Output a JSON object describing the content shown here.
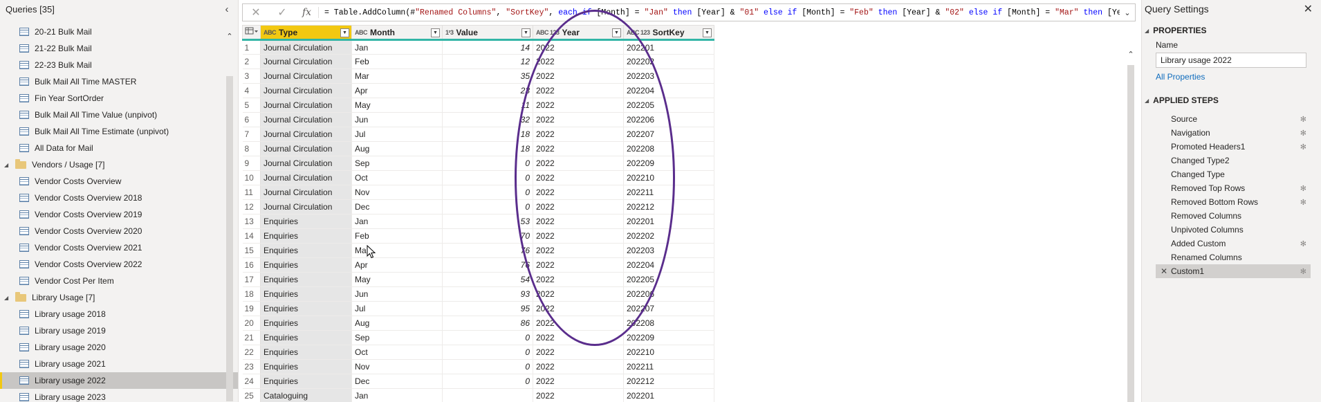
{
  "queries_pane": {
    "title": "Queries [35]",
    "collapse_icon": "chevron-left-icon",
    "items": [
      {
        "kind": "query",
        "label": "20-21 Bulk Mail"
      },
      {
        "kind": "query",
        "label": "21-22 Bulk Mail"
      },
      {
        "kind": "query",
        "label": "22-23 Bulk Mail"
      },
      {
        "kind": "query",
        "label": "Bulk Mail All Time MASTER"
      },
      {
        "kind": "query",
        "label": "Fin Year SortOrder"
      },
      {
        "kind": "query",
        "label": "Bulk Mail All Time Value (unpivot)"
      },
      {
        "kind": "query",
        "label": "Bulk Mail All Time Estimate (unpivot)"
      },
      {
        "kind": "query",
        "label": "All Data for Mail"
      },
      {
        "kind": "folder",
        "label": "Vendors / Usage [7]"
      },
      {
        "kind": "query",
        "label": "Vendor Costs Overview"
      },
      {
        "kind": "query",
        "label": "Vendor Costs Overview 2018"
      },
      {
        "kind": "query",
        "label": "Vendor Costs Overview 2019"
      },
      {
        "kind": "query",
        "label": "Vendor Costs Overview 2020"
      },
      {
        "kind": "query",
        "label": "Vendor Costs Overview 2021"
      },
      {
        "kind": "query",
        "label": "Vendor Costs Overview 2022"
      },
      {
        "kind": "query",
        "label": "Vendor Cost Per Item"
      },
      {
        "kind": "folder",
        "label": "Library Usage [7]"
      },
      {
        "kind": "query",
        "label": "Library usage 2018"
      },
      {
        "kind": "query",
        "label": "Library usage 2019"
      },
      {
        "kind": "query",
        "label": "Library usage 2020"
      },
      {
        "kind": "query",
        "label": "Library usage 2021"
      },
      {
        "kind": "query",
        "label": "Library usage 2022",
        "selected": true
      },
      {
        "kind": "query",
        "label": "Library usage 2023"
      }
    ]
  },
  "formula_bar": {
    "cancel_icon": "✕",
    "commit_icon": "✓",
    "fx_label": "fx",
    "parts": [
      {
        "t": "plain",
        "v": "= Table.AddColumn(#"
      },
      {
        "t": "str",
        "v": "\"Renamed Columns\""
      },
      {
        "t": "plain",
        "v": ", "
      },
      {
        "t": "str",
        "v": "\"SortKey\""
      },
      {
        "t": "plain",
        "v": ", "
      },
      {
        "t": "kw",
        "v": "each if "
      },
      {
        "t": "plain",
        "v": "[Month] = "
      },
      {
        "t": "str",
        "v": "\"Jan\""
      },
      {
        "t": "kw",
        "v": " then "
      },
      {
        "t": "plain",
        "v": "[Year] & "
      },
      {
        "t": "str",
        "v": "\"01\""
      },
      {
        "t": "kw",
        "v": " else if "
      },
      {
        "t": "plain",
        "v": "[Month] = "
      },
      {
        "t": "str",
        "v": "\"Feb\""
      },
      {
        "t": "kw",
        "v": " then "
      },
      {
        "t": "plain",
        "v": "[Year] & "
      },
      {
        "t": "str",
        "v": "\"02\""
      },
      {
        "t": "kw",
        "v": " else if "
      },
      {
        "t": "plain",
        "v": "[Month] = "
      },
      {
        "t": "str",
        "v": "\"Mar\""
      },
      {
        "t": "kw",
        "v": " then "
      },
      {
        "t": "plain",
        "v": "[Year] &"
      }
    ],
    "expand_icon": "chevron-down-icon"
  },
  "grid": {
    "columns": [
      {
        "name": "Type",
        "type_icon": "ABC",
        "highlight": true
      },
      {
        "name": "Month",
        "type_icon": "ABC"
      },
      {
        "name": "Value",
        "type_icon": "1²3"
      },
      {
        "name": "Year",
        "type_icon": "ABC 123"
      },
      {
        "name": "SortKey",
        "type_icon": "ABC 123"
      }
    ],
    "rows": [
      [
        "Journal Circulation",
        "Jan",
        "14",
        "2022",
        "202201"
      ],
      [
        "Journal Circulation",
        "Feb",
        "12",
        "2022",
        "202202"
      ],
      [
        "Journal Circulation",
        "Mar",
        "35",
        "2022",
        "202203"
      ],
      [
        "Journal Circulation",
        "Apr",
        "23",
        "2022",
        "202204"
      ],
      [
        "Journal Circulation",
        "May",
        "11",
        "2022",
        "202205"
      ],
      [
        "Journal Circulation",
        "Jun",
        "32",
        "2022",
        "202206"
      ],
      [
        "Journal Circulation",
        "Jul",
        "18",
        "2022",
        "202207"
      ],
      [
        "Journal Circulation",
        "Aug",
        "18",
        "2022",
        "202208"
      ],
      [
        "Journal Circulation",
        "Sep",
        "0",
        "2022",
        "202209"
      ],
      [
        "Journal Circulation",
        "Oct",
        "0",
        "2022",
        "202210"
      ],
      [
        "Journal Circulation",
        "Nov",
        "0",
        "2022",
        "202211"
      ],
      [
        "Journal Circulation",
        "Dec",
        "0",
        "2022",
        "202212"
      ],
      [
        "Enquiries",
        "Jan",
        "53",
        "2022",
        "202201"
      ],
      [
        "Enquiries",
        "Feb",
        "70",
        "2022",
        "202202"
      ],
      [
        "Enquiries",
        "Mar",
        "76",
        "2022",
        "202203"
      ],
      [
        "Enquiries",
        "Apr",
        "76",
        "2022",
        "202204"
      ],
      [
        "Enquiries",
        "May",
        "54",
        "2022",
        "202205"
      ],
      [
        "Enquiries",
        "Jun",
        "93",
        "2022",
        "202206"
      ],
      [
        "Enquiries",
        "Jul",
        "95",
        "2022",
        "202207"
      ],
      [
        "Enquiries",
        "Aug",
        "86",
        "2022",
        "202208"
      ],
      [
        "Enquiries",
        "Sep",
        "0",
        "2022",
        "202209"
      ],
      [
        "Enquiries",
        "Oct",
        "0",
        "2022",
        "202210"
      ],
      [
        "Enquiries",
        "Nov",
        "0",
        "2022",
        "202211"
      ],
      [
        "Enquiries",
        "Dec",
        "0",
        "2022",
        "202212"
      ],
      [
        "Cataloguing",
        "Jan",
        "",
        "2022",
        "202201"
      ]
    ]
  },
  "settings_pane": {
    "title": "Query Settings",
    "close_icon": "✕",
    "properties_title": "PROPERTIES",
    "name_label": "Name",
    "name_value": "Library usage 2022",
    "all_properties": "All Properties",
    "applied_steps_title": "APPLIED STEPS",
    "steps": [
      {
        "label": "Source",
        "gear": true
      },
      {
        "label": "Navigation",
        "gear": true
      },
      {
        "label": "Promoted Headers1",
        "gear": true
      },
      {
        "label": "Changed Type2",
        "gear": false
      },
      {
        "label": "Changed Type",
        "gear": false
      },
      {
        "label": "Removed Top Rows",
        "gear": true
      },
      {
        "label": "Removed Bottom Rows",
        "gear": true
      },
      {
        "label": "Removed Columns",
        "gear": false
      },
      {
        "label": "Unpivoted Columns",
        "gear": false
      },
      {
        "label": "Added Custom",
        "gear": true
      },
      {
        "label": "Renamed Columns",
        "gear": false
      },
      {
        "label": "Custom1",
        "gear": true,
        "selected": true
      }
    ]
  },
  "colors": {
    "accent_yellow": "#f2c811",
    "header_underline": "#33b5a6",
    "annotation_ellipse": "#5a2d8c",
    "link_blue": "#0f6cbd"
  }
}
